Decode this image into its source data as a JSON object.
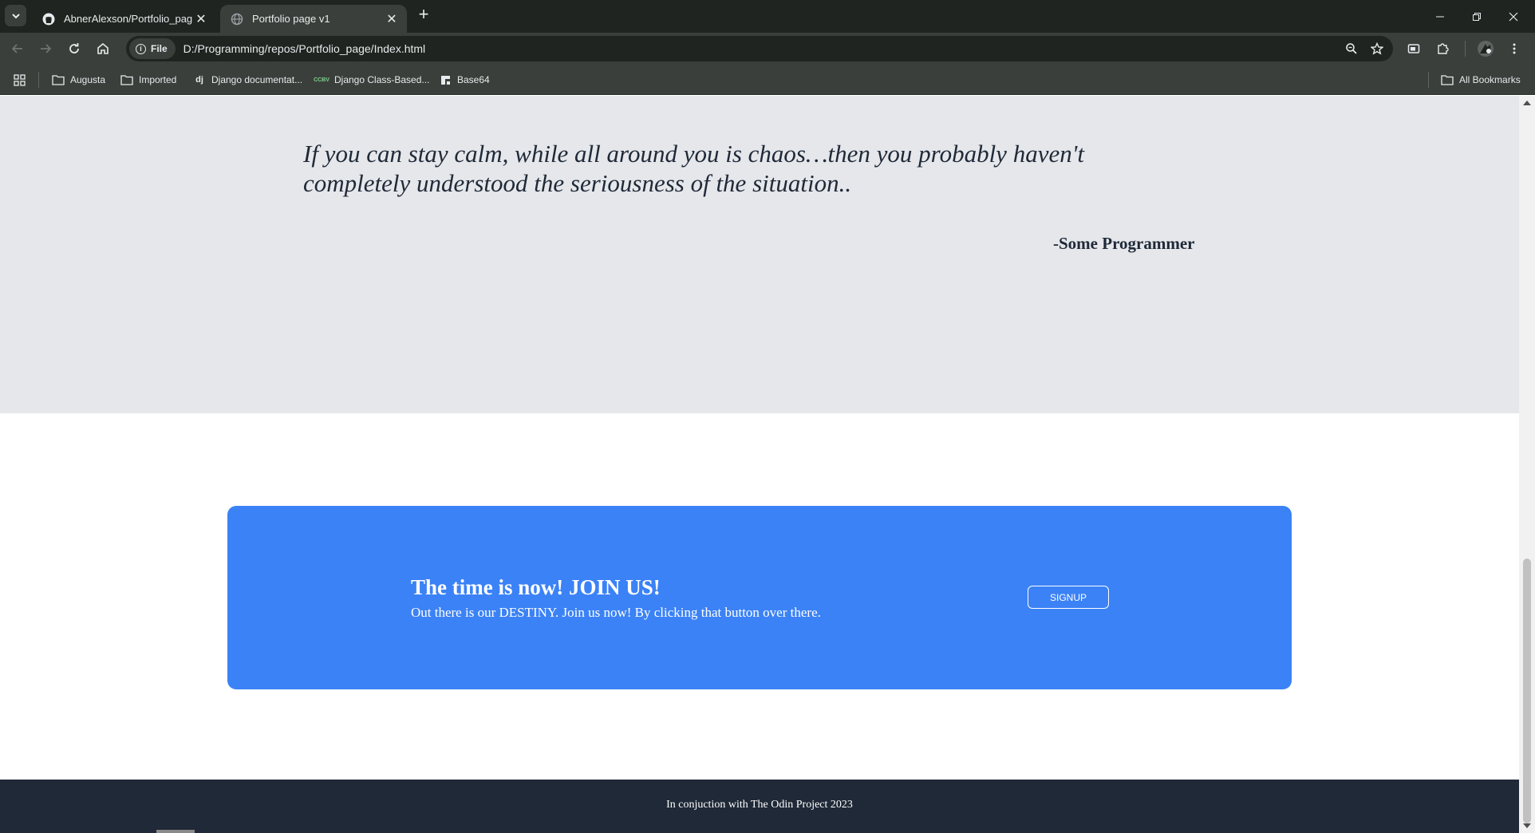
{
  "browser": {
    "tabs": [
      {
        "title": "AbnerAlexson/Portfolio_page",
        "icon": "github-icon"
      },
      {
        "title": "Portfolio page v1",
        "icon": "globe-icon",
        "active": true
      }
    ],
    "address": {
      "scheme_label": "File",
      "url": "D:/Programming/repos/Portfolio_page/Index.html"
    },
    "bookmarks": [
      {
        "label": "Augusta",
        "icon": "folder-icon"
      },
      {
        "label": "Imported",
        "icon": "folder-icon"
      },
      {
        "label": "Django documentat...",
        "icon": "django-icon",
        "badge": "dj"
      },
      {
        "label": "Django Class-Based...",
        "icon": "ccbv-icon",
        "badge": "CCBV"
      },
      {
        "label": "Base64",
        "icon": "base64-icon"
      }
    ],
    "all_bookmarks_label": "All Bookmarks"
  },
  "page": {
    "quote": {
      "text": "If you can stay calm, while all around you is chaos…then you probably haven't completely understood the seriousness of the situation..",
      "author": "-Some Programmer"
    },
    "cta": {
      "title": "The time is now! JOIN US!",
      "subtitle": "Out there is our DESTINY. Join us now! By clicking that button over there.",
      "button_label": "SIGNUP"
    },
    "footer": {
      "text": "In conjuction with The Odin Project 2023"
    }
  },
  "colors": {
    "quote_bg": "#e5e7eb",
    "cta_bg": "#3b82f6",
    "footer_bg": "#1f2937",
    "text_dark": "#1f2937"
  }
}
